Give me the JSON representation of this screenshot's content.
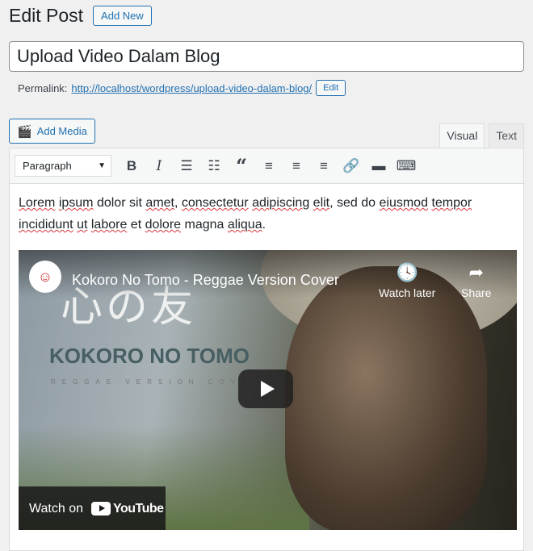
{
  "header": {
    "title": "Edit Post",
    "add_new": "Add New"
  },
  "post": {
    "title": "Upload Video Dalam Blog"
  },
  "permalink": {
    "label": "Permalink:",
    "url_prefix": "http://localhost/wordpress/",
    "slug": "upload-video-dalam-blog",
    "url_suffix": "/",
    "edit": "Edit"
  },
  "media": {
    "add_media": "Add Media"
  },
  "tabs": {
    "visual": "Visual",
    "text": "Text",
    "active": "Visual"
  },
  "toolbar": {
    "format": "Paragraph",
    "buttons": [
      "bold-icon",
      "italic-icon",
      "bulleted-list-icon",
      "numbered-list-icon",
      "blockquote-icon",
      "align-left-icon",
      "align-center-icon",
      "align-right-icon",
      "link-icon",
      "read-more-icon",
      "toolbar-toggle-icon"
    ]
  },
  "content": {
    "paragraph_words": [
      "Lorem",
      " ",
      "ipsum",
      " ",
      "dolor",
      " sit ",
      "amet",
      ", ",
      "consectetur",
      " ",
      "adipiscing",
      " ",
      "elit",
      ", sed do ",
      "eiusmod",
      " ",
      "tempor",
      " ",
      "incididunt",
      " ",
      "ut",
      " ",
      "labore",
      " et ",
      "dolore",
      " ",
      "magna",
      " ",
      "aliqua",
      "."
    ]
  },
  "video": {
    "title": "Kokoro No Tomo - Reggae Version Cover",
    "thumb_jp": "心の友",
    "thumb_title": "KOKORO NO TOMO",
    "thumb_subtitle": "REGGAE VERSION COVER",
    "watch_later": "Watch later",
    "share": "Share",
    "watch_on": "Watch on",
    "youtube": "YouTube"
  }
}
